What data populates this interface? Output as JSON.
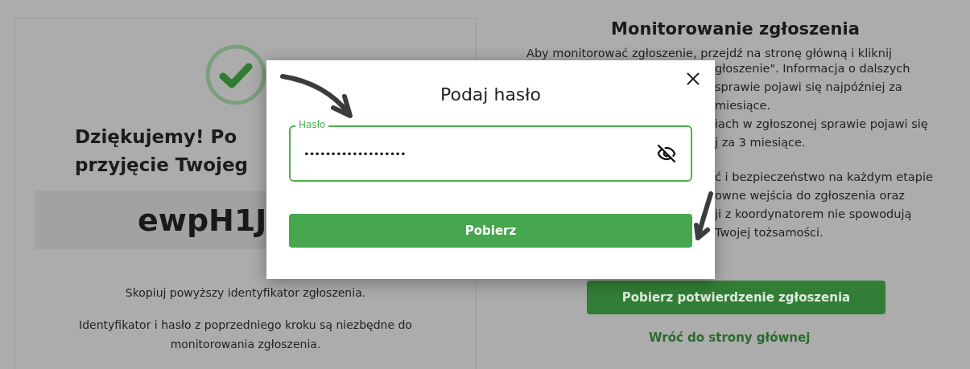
{
  "background": {
    "success_card": {
      "heading_lines": [
        "Dziękujemy! Po",
        "przyjęcie Twojeg"
      ],
      "identifier": "ewpH1J",
      "copy_hint": "Skopiuj powyższy identyfikator zgłoszenia.",
      "note": "Identyfikator i hasło z poprzedniego kroku są niezbędne do monitorowania zgłoszenia."
    },
    "monitoring": {
      "title": "Monitorowanie zgłoszenia",
      "intro_line": "Aby monitorować zgłoszenie, przejdź na stronę główną i kliknij",
      "paragraph_fragments": [
        [
          "głoszenie\". Informacja o dalszych",
          "sprawie pojawi się najpóźniej za",
          "miesiące.",
          "iach w zgłoszonej sprawie pojawi się",
          "j za 3 miesiące."
        ],
        [
          "ć i bezpieczeństwo na każdym etapie",
          "owne wejścia do zgłoszenia oraz",
          "ji z koordynatorem nie spowodują",
          "Twojej tożsamości."
        ]
      ],
      "download_button": "Pobierz potwierdzenie zgłoszenia",
      "home_link": "Wróć do strony głównej"
    }
  },
  "dialog": {
    "title": "Podaj hasło",
    "password_field": {
      "label": "Hasło",
      "value": "•••••••••••••••••••",
      "focused": true
    },
    "submit_button": "Pobierz"
  }
}
